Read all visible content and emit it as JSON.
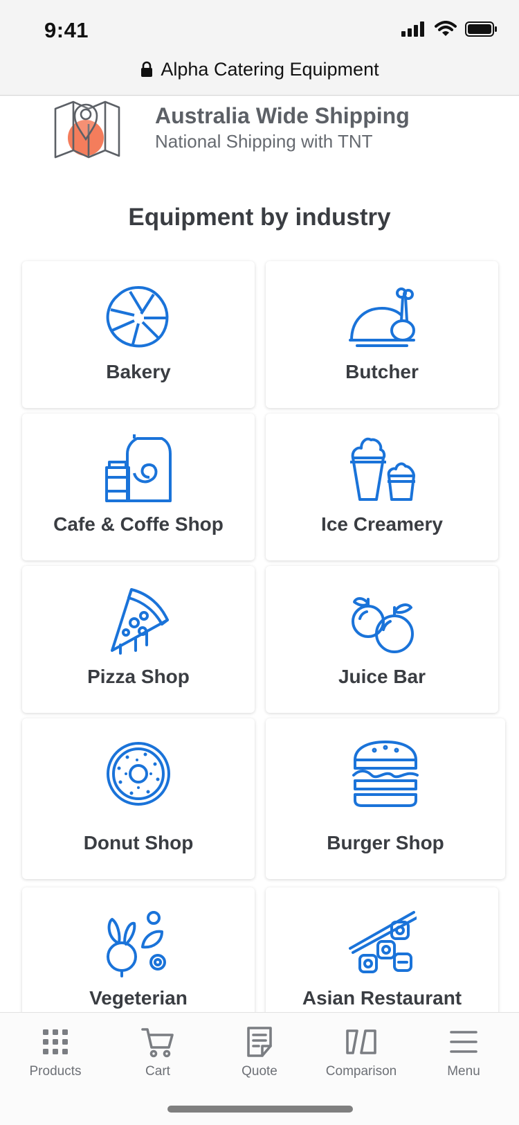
{
  "status": {
    "time": "9:41"
  },
  "browser": {
    "site_title": "Alpha Catering Equipment"
  },
  "shipping": {
    "title": "Australia Wide Shipping",
    "subtitle": "National Shipping with TNT"
  },
  "section": {
    "title": "Equipment by industry"
  },
  "industries": [
    {
      "label": "Bakery",
      "icon": "croissant-icon"
    },
    {
      "label": "Butcher",
      "icon": "roast-chicken-icon"
    },
    {
      "label": "Cafe & Coffe Shop",
      "icon": "coffee-bag-icon"
    },
    {
      "label": "Ice Creamery",
      "icon": "ice-cream-icon"
    },
    {
      "label": "Pizza Shop",
      "icon": "pizza-slice-icon"
    },
    {
      "label": "Juice Bar",
      "icon": "fruit-icon"
    },
    {
      "label": "Donut Shop",
      "icon": "donut-icon"
    },
    {
      "label": "Burger Shop",
      "icon": "burger-icon"
    },
    {
      "label": "Vegeterian",
      "icon": "vegetables-icon"
    },
    {
      "label": "Asian Restaurant",
      "icon": "sushi-icon"
    }
  ],
  "tabs": [
    {
      "label": "Products",
      "icon": "grid-icon"
    },
    {
      "label": "Cart",
      "icon": "cart-icon"
    },
    {
      "label": "Quote",
      "icon": "quote-icon"
    },
    {
      "label": "Comparison",
      "icon": "comparison-icon"
    },
    {
      "label": "Menu",
      "icon": "hamburger-icon"
    }
  ],
  "colors": {
    "accent": "#1a73d9",
    "map_pin": "#f47d5c",
    "text": "#3a3d42"
  }
}
